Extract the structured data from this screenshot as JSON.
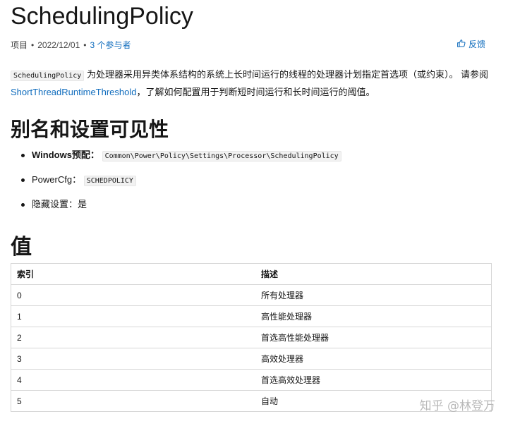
{
  "title": "SchedulingPolicy",
  "meta": {
    "type": "项目",
    "date": "2022/12/01",
    "contributors": "3 个参与者",
    "feedback": "反馈"
  },
  "description": {
    "code": "SchedulingPolicy",
    "text1": " 为处理器采用异类体系结构的系统上长时间运行的线程的处理器计划指定首选项（或约束）。 请参阅 ",
    "link": "ShortThreadRuntimeThreshold",
    "text2": "，了解如何配置用于判断短时间运行和长时间运行的阈值。"
  },
  "alias_section": {
    "heading": "别名和设置可见性",
    "items": [
      {
        "label": "Windows预配：",
        "code": "Common\\Power\\Policy\\Settings\\Processor\\SchedulingPolicy"
      },
      {
        "label": "PowerCfg：",
        "code": "SCHEDPOLICY"
      },
      {
        "label": "隐藏设置：是",
        "code": ""
      }
    ]
  },
  "values_section": {
    "heading": "值",
    "columns": [
      "索引",
      "描述"
    ],
    "rows": [
      [
        "0",
        "所有处理器"
      ],
      [
        "1",
        "高性能处理器"
      ],
      [
        "2",
        "首选高性能处理器"
      ],
      [
        "3",
        "高效处理器"
      ],
      [
        "4",
        "首选高效处理器"
      ],
      [
        "5",
        "自动"
      ]
    ]
  },
  "watermark": "知乎 @林登万",
  "icons": {
    "feedback": "thumbs-up-icon"
  }
}
